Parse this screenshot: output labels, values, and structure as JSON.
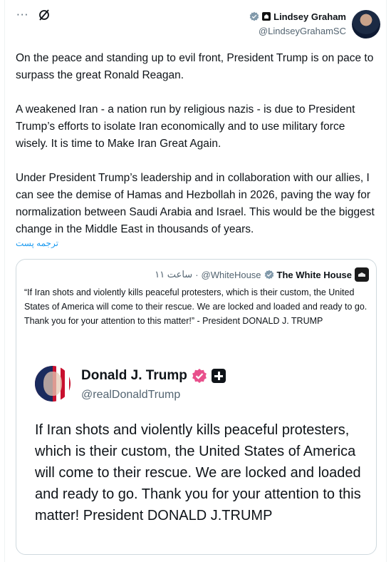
{
  "header": {
    "more_icon": "more-horizontal-icon",
    "more_glyph": "···",
    "grok_icon": "grok-icon",
    "author_name": "Lindsey Graham",
    "author_handle": "@LindseyGrahamSC",
    "verified_badge_color": "#829aab",
    "affiliation_icon": "us-government-icon"
  },
  "tweet": {
    "text": "On the peace and standing up to evil front, President Trump is on pace to surpass the great Ronald Reagan.\n\nA weakened Iran - a nation run by religious nazis - is due to President Trump’s efforts to isolate Iran economically and to use military force wisely. It is time to Make Iran Great Again.\n\nUnder President Trump’s leadership and in collaboration with our allies, I can see the demise of Hamas and Hezbollah in 2026, paving the way for normalization between Saudi Arabia and Israel. This would be the biggest change in the Middle East in thousands of years.",
    "translate_label": "ترجمه پست"
  },
  "quote": {
    "author_name": "The White House",
    "author_handle": "@WhiteHouse",
    "separator": "·",
    "time": "ساعت ١١",
    "verified_badge_color": "#829aab",
    "text": "“If Iran shots and violently kills peaceful protesters, which is their custom, the United States of America will come to their rescue. We are locked and loaded and ready to go. Thank you for your attention to this matter!” - President DONALD J. TRUMP",
    "media": {
      "name": "Donald J. Trump",
      "handle": "@realDonaldTrump",
      "verified_color": "#e8508c",
      "plus_icon": "plus-square-icon",
      "body": "If Iran shots and violently kills peaceful protesters, which is their custom, the United States of America will come to their rescue. We are locked and loaded and ready to go. Thank you for your attention to this matter! President DONALD J.TRUMP"
    }
  },
  "colors": {
    "link": "#1d9bf0",
    "text_primary": "#0f1419",
    "text_secondary": "#536471",
    "border": "#cfd9de"
  }
}
